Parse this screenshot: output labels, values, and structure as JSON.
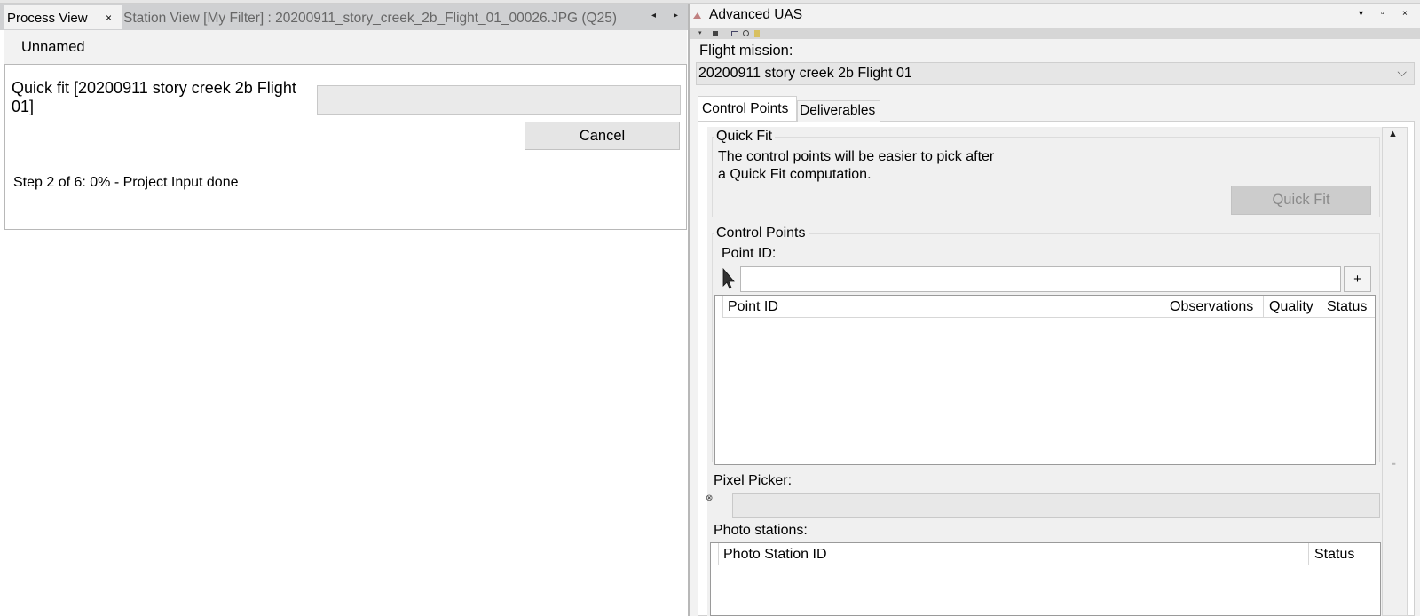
{
  "left_panel": {
    "tabs": [
      {
        "label": "Process View",
        "close_glyph": "×"
      },
      {
        "label": "Station View [My Filter] : 20200911_story_creek_2b_Flight_01_00026.JPG (Q25)"
      }
    ],
    "scroll_left": "◂",
    "scroll_right": "▸",
    "process_name": "Unnamed",
    "process": {
      "title": "Quick fit [20200911 story creek 2b Flight 01]",
      "progress_fraction": 0.0,
      "cancel_label": "Cancel",
      "step_text": "Step 2 of 6: 0% - Project Input done"
    }
  },
  "right_panel": {
    "title": "Advanced UAS",
    "window_controls": [
      "▾",
      "▫",
      "×"
    ],
    "toolbar_icons": [
      "dropdown-icon",
      "stop-icon",
      "screen-icon",
      "clock-icon",
      "doc-icon"
    ],
    "flight_mission_label": "Flight mission:",
    "flight_mission_value": "20200911 story creek 2b Flight 01",
    "tabs": [
      {
        "label": "Control Points",
        "active": true
      },
      {
        "label": "Deliverables",
        "active": false
      }
    ],
    "quick_fit_group": {
      "title": "Quick Fit",
      "description_line1": "The control points will be easier to pick after",
      "description_line2": "a Quick Fit computation.",
      "button_label": "Quick Fit"
    },
    "control_points_group": {
      "title": "Control Points",
      "point_id_label": "Point ID:",
      "point_id_value": "",
      "add_label": "+",
      "columns": [
        "Point ID",
        "Observations",
        "Quality",
        "Status"
      ],
      "rows": []
    },
    "pixel_picker_label": "Pixel Picker:",
    "photo_stations_label": "Photo stations:",
    "photo_stations_columns": [
      "Photo Station ID",
      "Status"
    ],
    "photo_stations_rows": []
  },
  "colors": {
    "tab_strip": "#cfd0d2",
    "panel_bg": "#f2f2f2",
    "disabled_button": "#cccccc"
  }
}
